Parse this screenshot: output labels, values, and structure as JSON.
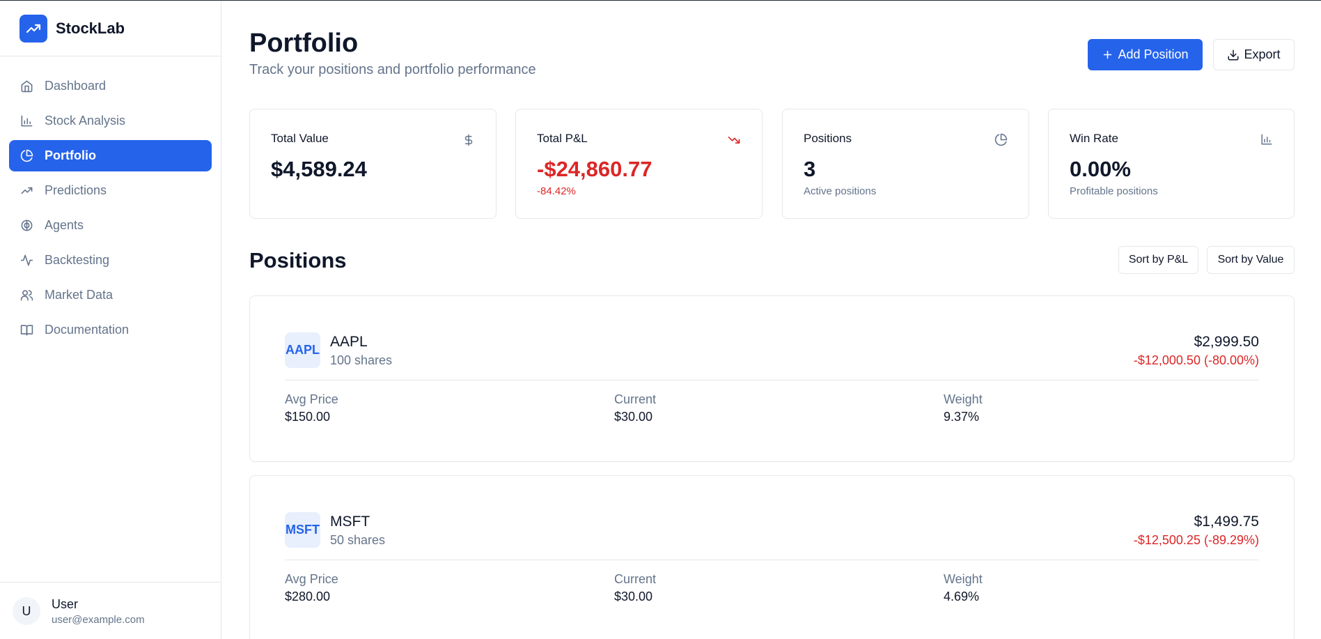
{
  "brand": {
    "name": "StockLab"
  },
  "nav": [
    {
      "label": "Dashboard",
      "icon": "home-icon",
      "active": false
    },
    {
      "label": "Stock Analysis",
      "icon": "bar-chart-icon",
      "active": false
    },
    {
      "label": "Portfolio",
      "icon": "pie-chart-icon",
      "active": true
    },
    {
      "label": "Predictions",
      "icon": "trending-up-icon",
      "active": false
    },
    {
      "label": "Agents",
      "icon": "brain-icon",
      "active": false
    },
    {
      "label": "Backtesting",
      "icon": "activity-icon",
      "active": false
    },
    {
      "label": "Market Data",
      "icon": "users-icon",
      "active": false
    },
    {
      "label": "Documentation",
      "icon": "book-icon",
      "active": false
    }
  ],
  "user": {
    "initial": "U",
    "name": "User",
    "email": "user@example.com"
  },
  "header": {
    "title": "Portfolio",
    "subtitle": "Track your positions and portfolio performance",
    "add_label": "Add Position",
    "export_label": "Export"
  },
  "stats": [
    {
      "label": "Total Value",
      "value": "$4,589.24",
      "sub": "",
      "icon": "dollar-icon",
      "negative": false
    },
    {
      "label": "Total P&L",
      "value": "-$24,860.77",
      "sub": "-84.42%",
      "icon": "trending-down-icon",
      "negative": true
    },
    {
      "label": "Positions",
      "value": "3",
      "sub": "Active positions",
      "icon": "pie-chart-icon",
      "negative": false
    },
    {
      "label": "Win Rate",
      "value": "0.00%",
      "sub": "Profitable positions",
      "icon": "bar-chart-icon",
      "negative": false
    }
  ],
  "positions_section": {
    "title": "Positions",
    "sort_pnl": "Sort by P&L",
    "sort_value": "Sort by Value"
  },
  "positions": [
    {
      "symbol": "AAPL",
      "shares": "100 shares",
      "value": "$2,999.50",
      "pnl": "-$12,000.50 (-80.00%)",
      "avg_label": "Avg Price",
      "avg": "$150.00",
      "current_label": "Current",
      "current": "$30.00",
      "weight_label": "Weight",
      "weight": "9.37%"
    },
    {
      "symbol": "MSFT",
      "shares": "50 shares",
      "value": "$1,499.75",
      "pnl": "-$12,500.25 (-89.29%)",
      "avg_label": "Avg Price",
      "avg": "$280.00",
      "current_label": "Current",
      "current": "$30.00",
      "weight_label": "Weight",
      "weight": "4.69%"
    }
  ],
  "colors": {
    "accent": "#2563eb",
    "negative": "#dc2626",
    "muted": "#64748b",
    "border": "#e5e7eb"
  }
}
